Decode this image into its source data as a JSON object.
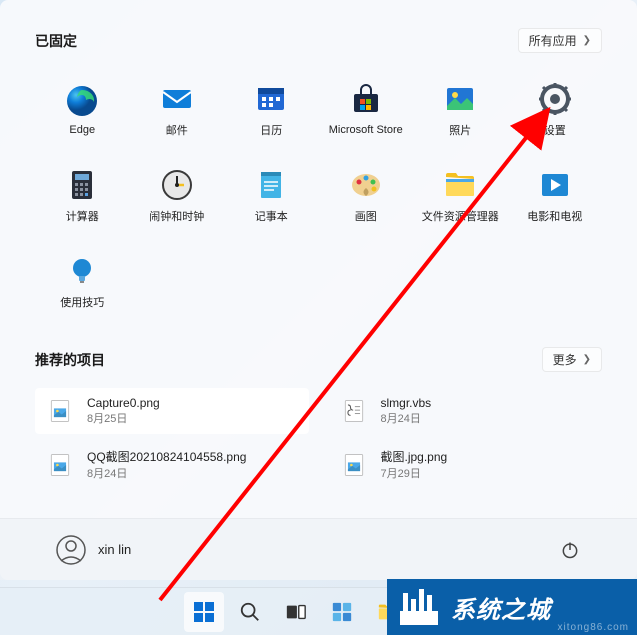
{
  "pinned": {
    "title": "已固定",
    "allAppsLabel": "所有应用",
    "apps": [
      {
        "name": "Edge",
        "icon": "edge"
      },
      {
        "name": "邮件",
        "icon": "mail"
      },
      {
        "name": "日历",
        "icon": "calendar"
      },
      {
        "name": "Microsoft Store",
        "icon": "store"
      },
      {
        "name": "照片",
        "icon": "photos"
      },
      {
        "name": "设置",
        "icon": "settings"
      },
      {
        "name": "计算器",
        "icon": "calculator"
      },
      {
        "name": "闹钟和时钟",
        "icon": "clock"
      },
      {
        "name": "记事本",
        "icon": "notepad"
      },
      {
        "name": "画图",
        "icon": "paint"
      },
      {
        "name": "文件资源管理器",
        "icon": "explorer"
      },
      {
        "name": "电影和电视",
        "icon": "movies"
      },
      {
        "name": "使用技巧",
        "icon": "tips"
      }
    ]
  },
  "recommended": {
    "title": "推荐的项目",
    "moreLabel": "更多",
    "items": [
      {
        "name": "Capture0.png",
        "date": "8月25日",
        "icon": "image",
        "highlight": true
      },
      {
        "name": "slmgr.vbs",
        "date": "8月24日",
        "icon": "script",
        "highlight": false
      },
      {
        "name": "QQ截图20210824104558.png",
        "date": "8月24日",
        "icon": "image",
        "highlight": false
      },
      {
        "name": "截图.jpg.png",
        "date": "7月29日",
        "icon": "image",
        "highlight": false
      }
    ]
  },
  "user": {
    "name": "xin lin"
  },
  "watermark": {
    "text": "系统之城",
    "sub": "xitong86.com"
  },
  "annotation": {
    "arrowColor": "#ff0000"
  }
}
